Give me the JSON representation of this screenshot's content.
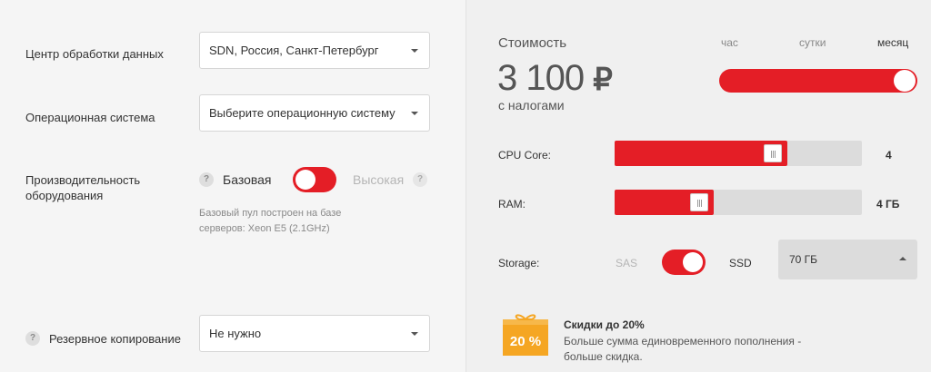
{
  "config": {
    "datacenter": {
      "label": "Центр обработки данных",
      "value": "SDN, Россия, Санкт-Петербург"
    },
    "os": {
      "label": "Операционная система",
      "placeholder": "Выберите операционную систему"
    },
    "performance": {
      "label_line1": "Производительность",
      "label_line2": "оборудования",
      "option_base": "Базовая",
      "option_high": "Высокая",
      "help_icon": "question-icon",
      "hint_line1": "Базовый пул построен на базе",
      "hint_line2": "серверов: Xeon E5 (2.1GHz)"
    },
    "backup": {
      "label": "Резервное копирование",
      "value": "Не нужно"
    }
  },
  "summary": {
    "caption": "Стоимость",
    "price": "3 100",
    "currency": "₽",
    "tax_note": "с налогами",
    "periods": [
      "час",
      "сутки",
      "месяц"
    ],
    "selected_period": "месяц",
    "cpu": {
      "label": "CPU Core:",
      "value": "4",
      "fill_fraction": 0.7
    },
    "ram": {
      "label": "RAM:",
      "value": "4 ГБ",
      "fill_fraction": 0.4
    },
    "storage": {
      "label": "Storage:",
      "option_sas": "SAS",
      "option_ssd": "SSD",
      "size": "70 ГБ"
    },
    "promo": {
      "badge": "20 %",
      "title": "Скидки до 20%",
      "line1": "Больше сумма единовременного пополнения -",
      "line2": "больше скидка."
    }
  },
  "colors": {
    "accent": "#e41e26",
    "gift": "#f5a623"
  }
}
